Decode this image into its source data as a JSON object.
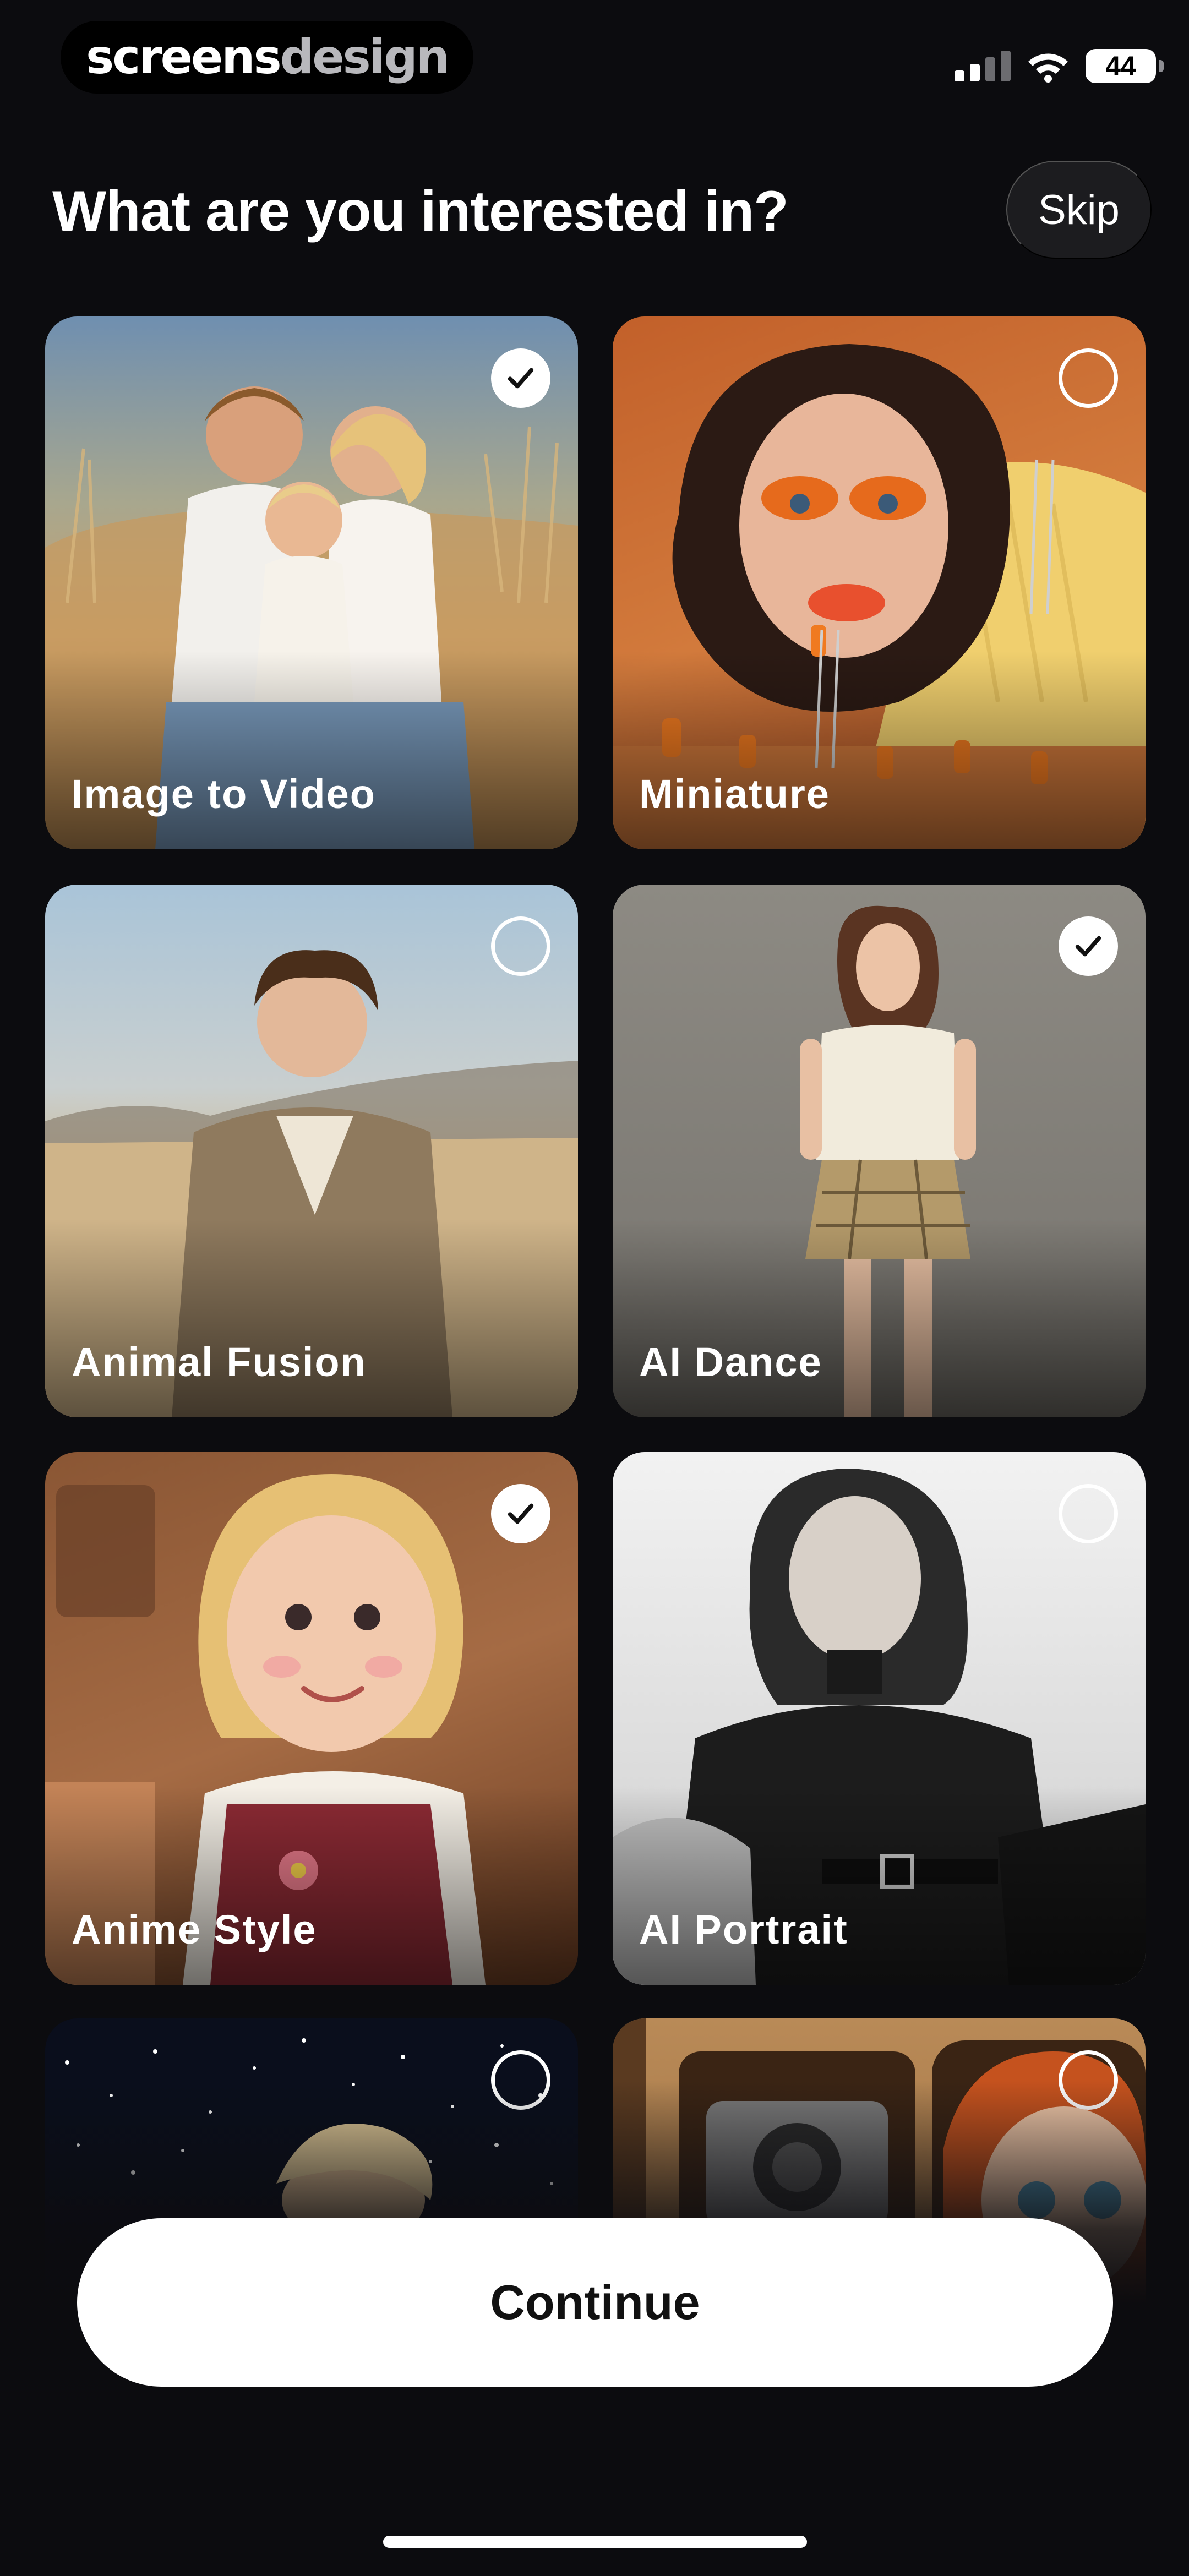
{
  "watermark": {
    "part1": "screens",
    "part2": "design"
  },
  "status_bar": {
    "battery": "44"
  },
  "header": {
    "title": "What are you interested in?",
    "skip_label": "Skip"
  },
  "categories": [
    {
      "label": "Image to Video",
      "selected": true
    },
    {
      "label": "Miniature",
      "selected": false
    },
    {
      "label": "Animal Fusion",
      "selected": false
    },
    {
      "label": "AI Dance",
      "selected": true
    },
    {
      "label": "Anime Style",
      "selected": true
    },
    {
      "label": "AI Portrait",
      "selected": false
    },
    {
      "label": "",
      "selected": false
    },
    {
      "label": "",
      "selected": false
    }
  ],
  "footer": {
    "continue_label": "Continue"
  }
}
